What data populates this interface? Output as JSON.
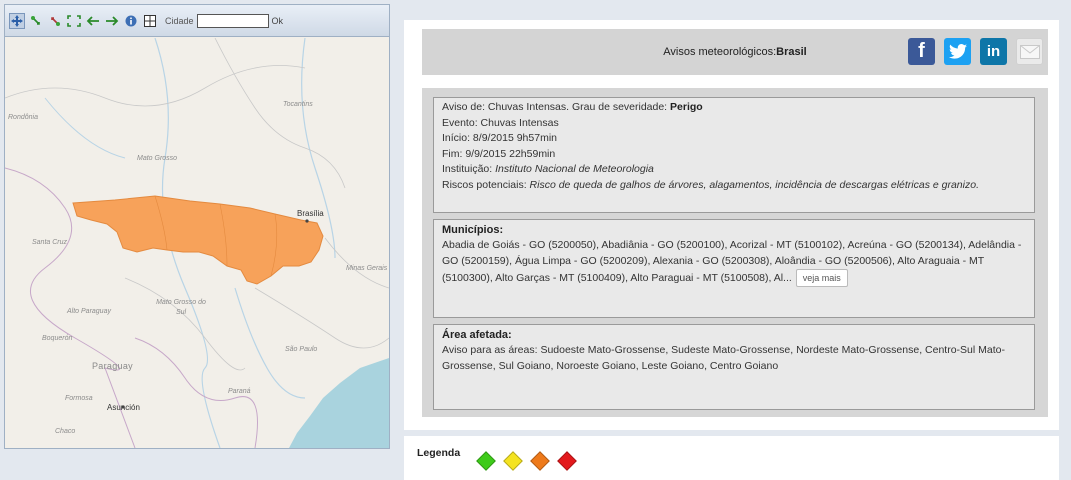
{
  "map": {
    "toolbar": {
      "tools": [
        "pan-icon",
        "zoom-in-icon",
        "zoom-out-icon",
        "zoom-extent-icon",
        "back-arrow-icon",
        "forward-arrow-icon",
        "info-icon",
        "grid-icon"
      ],
      "city_label": "Cidade",
      "city_value": "",
      "ok_label": "Ok"
    },
    "labels": {
      "tocantins": "Tocantins",
      "rondonia": "Rondônia",
      "mato_grosso": "Mato Grosso",
      "brasilia": "Brasília",
      "santa_cruz": "Santa Cruz",
      "minas_gerais": "Minas Gerais",
      "mato_grosso_do_sul": "Mato Grosso do Sul",
      "alto_paraguay": "Alto Paraguay",
      "boqueron": "Boquerón",
      "paraguay": "Paraguay",
      "sao_paulo": "São Paulo",
      "formosa": "Formosa",
      "asuncion": "Asunción",
      "parana": "Paraná",
      "chaco": "Chaco"
    },
    "colors": {
      "land": "#f2efe9",
      "water": "#a9d3de",
      "alert_area": "#f7a25a",
      "alert_border": "#e48a3f"
    }
  },
  "warning": {
    "title_prefix": "Avisos meteorológicos:",
    "title_location": "Brasil",
    "share": {
      "facebook": "f",
      "twitter": "t",
      "linkedin": "in",
      "email_icon": "mail-icon"
    },
    "details": {
      "aviso_label": "Aviso de: Chuvas Intensas. Grau de severidade: ",
      "severity": "Perigo",
      "evento": "Evento: Chuvas Intensas",
      "inicio": "Início: 8/9/2015 9h57min",
      "fim": "Fim: 9/9/2015 22h59min",
      "instituicao_label": "Instituição: ",
      "instituicao": "Instituto Nacional de Meteorologia",
      "riscos_label": "Riscos potenciais: ",
      "riscos": "Risco de queda de galhos de árvores, alagamentos, incidência de descargas elétricas e granizo."
    },
    "municipios": {
      "title": "Municípios:",
      "text": "Abadia de Goiás - GO (5200050), Abadiânia - GO (5200100), Acorizal - MT (5100102), Acreúna - GO (5200134), Adelândia - GO (5200159), Água Limpa - GO (5200209), Alexania - GO (5200308), Aloândia - GO (5200506), Alto Araguaia - MT (5100300), Alto Garças - MT (5100409), Alto Paraguai - MT (5100508), Al...",
      "more_button": "veja mais"
    },
    "area": {
      "title": "Área afetada:",
      "text": "Aviso para as áreas: Sudoeste Mato-Grossense, Sudeste Mato-Grossense, Nordeste Mato-Grossense, Centro-Sul Mato-Grossense, Sul Goiano, Noroeste Goiano, Leste Goiano, Centro Goiano"
    }
  },
  "legend": {
    "label": "Legenda",
    "levels": [
      {
        "color": "#3ecb1a"
      },
      {
        "color": "#f4e321"
      },
      {
        "color": "#ee7a1a"
      },
      {
        "color": "#e3191c"
      }
    ]
  }
}
